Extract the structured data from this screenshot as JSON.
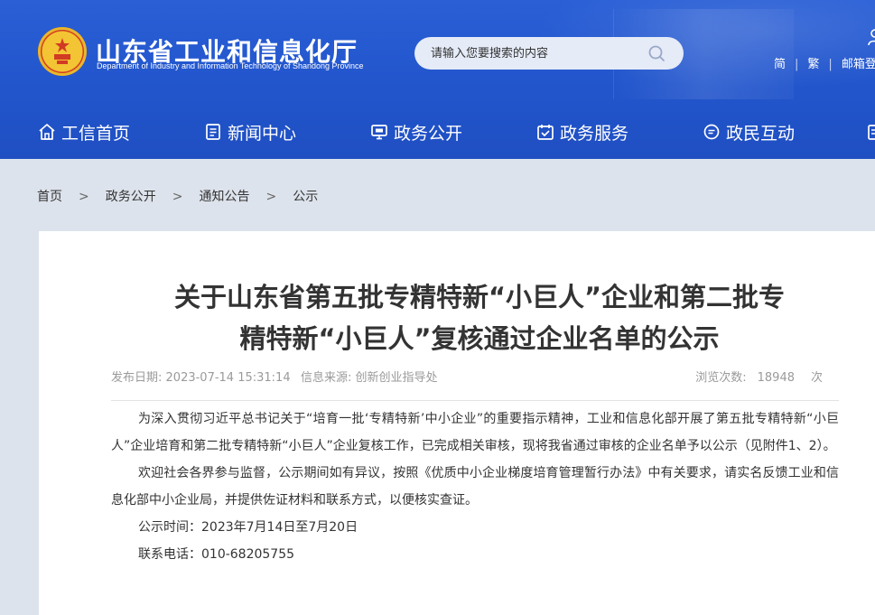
{
  "site": {
    "title": "山东省工业和信息化厅",
    "subtitle": "Department of Industry and Information Technology of Shandong Province",
    "emblem_icon": "national-emblem-icon"
  },
  "search": {
    "placeholder": "请输入您要搜索的内容",
    "icon": "search-icon"
  },
  "top_links": {
    "simplified": "简",
    "traditional": "繁",
    "mailbox": "邮箱登"
  },
  "nav": {
    "items": [
      {
        "label": "工信首页",
        "icon": "home-icon"
      },
      {
        "label": "新闻中心",
        "icon": "news-icon"
      },
      {
        "label": "政务公开",
        "icon": "monitor-icon"
      },
      {
        "label": "政务服务",
        "icon": "service-icon"
      },
      {
        "label": "政民互动",
        "icon": "chat-icon"
      }
    ]
  },
  "breadcrumb": {
    "items": [
      "首页",
      "政务公开",
      "通知公告",
      "公示"
    ],
    "separator": ">"
  },
  "article": {
    "title_line1": "关于山东省第五批专精特新“小巨人”企业和第二批专",
    "title_line2": "精特新“小巨人”复核通过企业名单的公示",
    "date_label": "发布日期:",
    "date": "2023-07-14 15:31:14",
    "source_label": "信息来源:",
    "source": "创新创业指导处",
    "views_label": "浏览次数:",
    "views": "18948",
    "views_unit": "次",
    "paragraphs": [
      "为深入贯彻习近平总书记关于“培育一批‘专精特新’中小企业”的重要指示精神，工业和信息化部开展了第五批专精特新“小巨人”企业培育和第二批专精特新“小巨人”企业复核工作，已完成相关审核，现将我省通过审核的企业名单予以公示（见附件1、2）。",
      "欢迎社会各界参与监督，公示期间如有异议，按照《优质中小企业梯度培育管理暂行办法》中有关要求，请实名反馈工业和信息化部中小企业局，并提供佐证材料和联系方式，以便核实查证。"
    ],
    "period": "公示时间：2023年7月14日至7月20日",
    "phone": "联系电话：010-68205755"
  },
  "colors": {
    "header_blue": "#2255cc",
    "page_bg": "#dde3ec",
    "text": "#333333",
    "meta_gray": "#9a9a9a"
  }
}
